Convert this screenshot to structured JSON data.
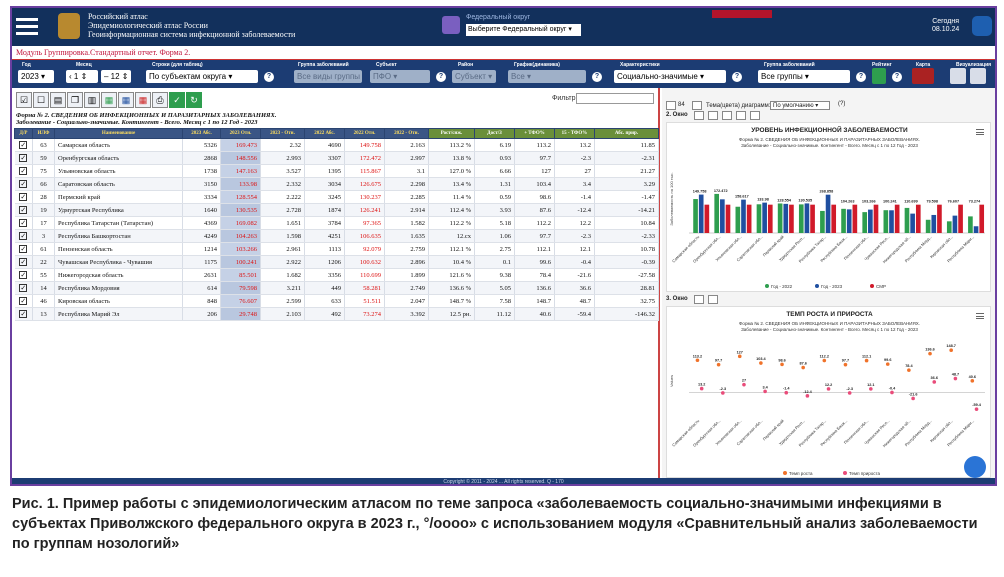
{
  "header": {
    "app_title_line1": "Российский атлас",
    "app_title_line2": "Эпидемиологический атлас России",
    "app_title_line3": "Геоинформационная система инфекционной заболеваемости",
    "federal_caption": "Федеральный округ",
    "federal_select": "Выберите Федеральный округ",
    "date_line1": "Сегодня",
    "date_line2": "08.10.24"
  },
  "module": {
    "title": "Модуль Группировка.Стандартный отчет. Форма 2."
  },
  "filters": {
    "year_label": "Год",
    "year_value": "2023",
    "month_label": "Месяц",
    "month_from": "1",
    "month_to": "12",
    "table_label": "Строки (для таблиц)",
    "table_value": "По субъектам округа",
    "disease_group_label": "Группа заболеваний",
    "disease_group_value": "Все виды группы",
    "subject_label": "Субъект",
    "subject_value": "ПФО",
    "district_label": "Район",
    "district_value": "Субъект",
    "graph_label": "График(динамика)",
    "graph_value": "Все",
    "character_label": "Характеристики",
    "character_value": "Социально-значимые",
    "group_label": "Группа заболеваний",
    "group_value": "Все группы",
    "rating_label": "Рейтинг",
    "map_label": "Карта",
    "vis_label": "Визуализация"
  },
  "toolbar": {
    "filter_label": "Фильтр:",
    "form_title_line1": "Форма № 2. СВЕДЕНИЯ ОБ ИНФЕКЦИОННЫХ И ПАРАЗИТАРНЫХ ЗАБОЛЕВАНИЯХ.",
    "form_title_line2": "Заболевание - Социально-значимые. Контингент - Всего. Месяц с 1 по 12 Год - 2023"
  },
  "table": {
    "headers": [
      "Д/Р",
      "ИЛФ",
      "Наименование",
      "2023 Абс.",
      "2023 Отн.",
      "2023 - Отн.",
      "2022 Абс.",
      "2022 Отн.",
      "2022 - Отн.",
      "Рост/снж.",
      "Дост/З",
      "+ ТФО%",
      "15 - ТФО%",
      "Абс. прир."
    ],
    "rows": [
      [
        "63",
        "Самарская область",
        "5326",
        "169.473",
        "2.32",
        "4690",
        "149.758",
        "2.163",
        "113.2 %",
        "6.19",
        "113.2",
        "13.2",
        "11.85"
      ],
      [
        "59",
        "Оренбургская область",
        "2868",
        "148.556",
        "2.993",
        "3307",
        "172.472",
        "2.997",
        "13.8 %",
        "0.93",
        "97.7",
        "-2.3",
        "-2.31"
      ],
      [
        "75",
        "Ульяновская область",
        "1738",
        "147.163",
        "3.527",
        "1395",
        "115.867",
        "3.1",
        "127.0 %",
        "6.66",
        "127",
        "27",
        "21.27"
      ],
      [
        "66",
        "Саратовская область",
        "3150",
        "133.98",
        "2.332",
        "3034",
        "126.675",
        "2.298",
        "13.4 %",
        "1.31",
        "103.4",
        "3.4",
        "3.29"
      ],
      [
        "28",
        "Пермский край",
        "3334",
        "128.554",
        "2.222",
        "3245",
        "130.237",
        "2.285",
        "11.4 %",
        "0.59",
        "98.6",
        "-1.4",
        "-1.47"
      ],
      [
        "19",
        "Удмуртская Республика",
        "1640",
        "130.535",
        "2.728",
        "1874",
        "126.241",
        "2.914",
        "112.4 %",
        "3.93",
        "87.6",
        "-12.4",
        "-14.21"
      ],
      [
        "17",
        "Республика Татарстан (Татарстан)",
        "4369",
        "169.082",
        "1.651",
        "3784",
        "97.365",
        "1.582",
        "112.2 %",
        "5.18",
        "112.2",
        "12.2",
        "10.84"
      ],
      [
        "3",
        "Республика Башкортостан",
        "4249",
        "104.263",
        "1.598",
        "4251",
        "106.635",
        "1.635",
        "12.cx",
        "1.06",
        "97.7",
        "-2.3",
        "-2.33"
      ],
      [
        "61",
        "Пензенская область",
        "1214",
        "103.266",
        "2.961",
        "1113",
        "92.079",
        "2.759",
        "112.1 %",
        "2.75",
        "112.1",
        "12.1",
        "10.78"
      ],
      [
        "22",
        "Чувашская Республика - Чувашия",
        "1175",
        "100.241",
        "2.922",
        "1206",
        "100.632",
        "2.896",
        "10.4 %",
        "0.1",
        "99.6",
        "-0.4",
        "-0.39"
      ],
      [
        "55",
        "Нижегородская область",
        "2631",
        "85.501",
        "1.682",
        "3356",
        "110.699",
        "1.899",
        "121.6 %",
        "9.38",
        "78.4",
        "-21.6",
        "-27.58"
      ],
      [
        "14",
        "Республика Мордовия",
        "614",
        "79.598",
        "3.211",
        "449",
        "58.281",
        "2.749",
        "136.6 %",
        "5.05",
        "136.6",
        "36.6",
        "28.81"
      ],
      [
        "46",
        "Кировская область",
        "848",
        "76.607",
        "2.599",
        "633",
        "51.511",
        "2.047",
        "148.7 %",
        "7.58",
        "148.7",
        "48.7",
        "32.75"
      ],
      [
        "13",
        "Республика Марий Эл",
        "206",
        "29.748",
        "2.103",
        "492",
        "73.274",
        "3.392",
        "12.5 рн.",
        "11.12",
        "40.6",
        "-59.4",
        "-146.32"
      ]
    ]
  },
  "right_panel": {
    "slot2_label": "2. Окно",
    "diagram_label": "Тема(цвета) диаграмм:",
    "diagram_select": "По умолчанию",
    "slot3_label": "3. Окно",
    "slot_num": "84"
  },
  "chart_data": [
    {
      "type": "bar",
      "title": "УРОВЕНЬ ИНФЕКЦИОННОЙ ЗАБОЛЕВАЕМОСТИ",
      "subtitle1": "Форма № 2. СВЕДЕНИЯ ОБ ИНФЕКЦИОННЫХ И ПАРАЗИТАРНЫХ ЗАБОЛЕВАНИЯХ.",
      "subtitle2": "Заболевание - Социально-значимые. Контингент - Всего. Месяц с 1 по 12 Год - 2023",
      "ylabel": "Заболеваемость на 100 тыс.",
      "categories": [
        "Самарская область",
        "Оренбургская обл...",
        "Ульяновская обл...",
        "Саратовская обл...",
        "Пермский край",
        "Удмуртская Респ...",
        "Республика Татар...",
        "Республика Башк...",
        "Пензенская обл...",
        "Чувашская Респ...",
        "Нижегородская об...",
        "Республика Морд...",
        "Кировская обл...",
        "Республика Мари..."
      ],
      "series": [
        {
          "name": "Год - 2022",
          "color": "#2e9e4e",
          "values": [
            149.758,
            172.472,
            115.867,
            126.675,
            130.237,
            126.241,
            97.365,
            106.635,
            92.079,
            100.632,
            110.699,
            58.281,
            51.511,
            73.274
          ]
        },
        {
          "name": "Год - 2023",
          "color": "#1f4fa0",
          "values": [
            169.473,
            148.556,
            147.163,
            133.98,
            128.554,
            130.535,
            169.082,
            104.263,
            103.266,
            100.241,
            85.501,
            79.598,
            76.607,
            29.748
          ]
        },
        {
          "name": "СМР",
          "color": "#d11a2a",
          "values": [
            125.0,
            125.0,
            125.0,
            125.0,
            125.0,
            125.0,
            125.0,
            125.0,
            125.0,
            125.0,
            125.0,
            125.0,
            125.0,
            125.0
          ]
        }
      ],
      "labels": [
        "149.758",
        "172.472",
        "158.617",
        "133.98",
        "128.554",
        "130.535",
        "268.858",
        "104.263",
        "103.266",
        "100.241",
        "110.699",
        "79.598",
        "76.607",
        "73.274"
      ],
      "ylim": [
        0,
        300
      ]
    },
    {
      "type": "scatter",
      "title": "ТЕМП РОСТА И ПРИРОСТА",
      "subtitle1": "Форма № 2. СВЕДЕНИЯ ОБ ИНФЕКЦИОННЫХ И ПАРАЗИТАРНЫХ ЗАБОЛЕВАНИЯХ.",
      "subtitle2": "Заболевание - Социально-значимые. Контингент - Всего. Месяц с 1 по 12 Год - 2023",
      "ylabel": "Values",
      "categories": [
        "Самарская область",
        "Оренбургская обл...",
        "Ульяновская обл...",
        "Саратовская обл...",
        "Пермский край",
        "Удмуртская Респ...",
        "Республика Татар...",
        "Республика Башк...",
        "Пензенская обл...",
        "Чувашская Респ...",
        "Нижегородская об...",
        "Республика Морд...",
        "Кировская обл...",
        "Республика Мари..."
      ],
      "series": [
        {
          "name": "Темп роста",
          "color": "#f0722a",
          "values": [
            113.2,
            97.7,
            127,
            103.4,
            98.6,
            87.6,
            112.2,
            97.7,
            112.1,
            99.6,
            78.4,
            136.6,
            148.7,
            40.6
          ]
        },
        {
          "name": "Темп прироста",
          "color": "#e94c7a",
          "values": [
            13.2,
            -2.3,
            27,
            3.4,
            -1.4,
            -12.4,
            12.2,
            -2.3,
            12.1,
            -0.4,
            -21.6,
            36.6,
            48.7,
            -59.4
          ]
        }
      ],
      "ylim": [
        -80,
        160
      ]
    }
  ],
  "footer": {
    "text": "Copyright © 2011 - 2024 ... All rights reserved. Q - 170"
  },
  "caption": {
    "text": "Рис. 1. Пример работы с эпидемиологическим атласом по теме запроса «заболеваемость социально-значимыми инфекциями в субъектах Приволжского федерального округа в 2023 г., °/oooo» с использованием модуля «Сравнительный анализ заболеваемости по группам нозологий»"
  }
}
